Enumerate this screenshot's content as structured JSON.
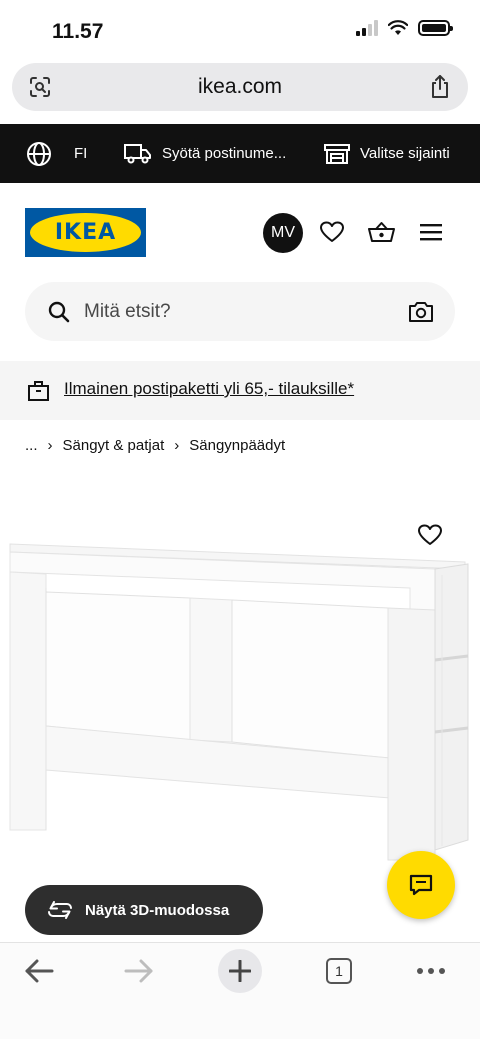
{
  "status_bar": {
    "time": "11.57"
  },
  "browser": {
    "url": "ikea.com"
  },
  "top_bar": {
    "language": "FI",
    "postcode_label": "Syötä postinume...",
    "store_label": "Valitse sijainti"
  },
  "header": {
    "logo_text": "IKEA",
    "avatar_initials": "MV"
  },
  "search": {
    "placeholder": "Mitä etsit?"
  },
  "promo": {
    "text": "Ilmainen postipaketti yli 65,- tilauksille*"
  },
  "breadcrumb": [
    "...",
    "Sängyt & patjat",
    "Sängynpäädyt"
  ],
  "product": {
    "view_3d_label": "Näytä 3D-muodossa"
  },
  "bottom_nav": {
    "tab_count": "1"
  },
  "colors": {
    "ikea_blue": "#0058a3",
    "ikea_yellow": "#ffdb00",
    "top_bar_bg": "#111111",
    "button_dark": "#2e2e2e"
  }
}
